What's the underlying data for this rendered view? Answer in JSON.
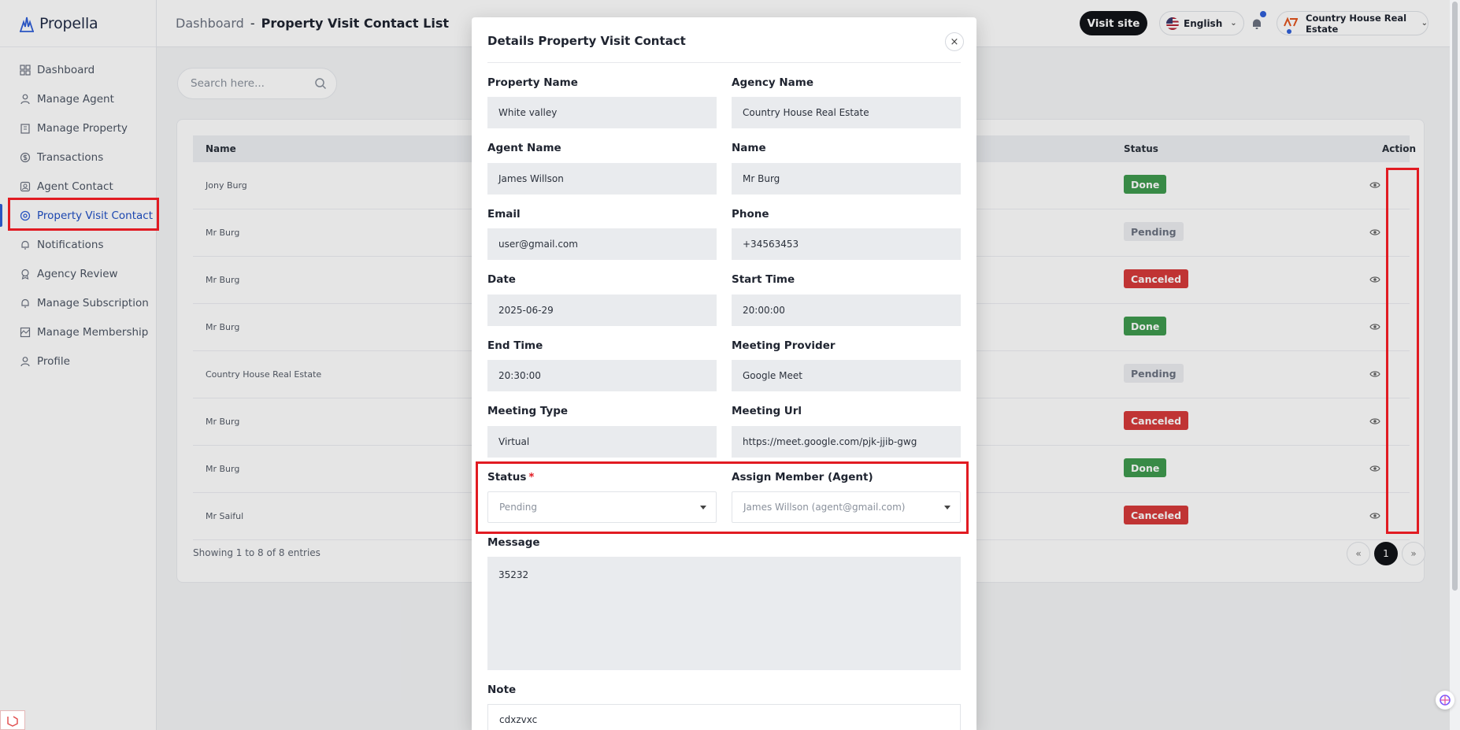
{
  "brand": {
    "name": "Propella"
  },
  "sidebar": {
    "items": [
      {
        "label": "Dashboard",
        "icon": "grid-icon"
      },
      {
        "label": "Manage Agent",
        "icon": "user-tie-icon"
      },
      {
        "label": "Manage Property",
        "icon": "building-icon"
      },
      {
        "label": "Transactions",
        "icon": "dollar-circle-icon"
      },
      {
        "label": "Agent Contact",
        "icon": "contact-card-icon"
      },
      {
        "label": "Property Visit Contact",
        "icon": "visit-icon"
      },
      {
        "label": "Notifications",
        "icon": "bell-icon"
      },
      {
        "label": "Agency Review",
        "icon": "badge-icon"
      },
      {
        "label": "Manage Subscription",
        "icon": "bell-outline-icon"
      },
      {
        "label": "Manage Membership",
        "icon": "membership-icon"
      },
      {
        "label": "Profile",
        "icon": "user-icon"
      }
    ],
    "active_index": 5
  },
  "header": {
    "breadcrumb_root": "Dashboard",
    "breadcrumb_sep": "-",
    "breadcrumb_current": "Property Visit Contact List",
    "visit_site": "Visit site",
    "language": "English",
    "account": "Country House Real Estate"
  },
  "search": {
    "placeholder": "Search here..."
  },
  "table": {
    "columns": {
      "name": "Name",
      "status": "Status",
      "action": "Action"
    },
    "rows": [
      {
        "name": "Jony Burg",
        "status": "Done",
        "kind": "done"
      },
      {
        "name": "Mr Burg",
        "status": "Pending",
        "kind": "pending"
      },
      {
        "name": "Mr Burg",
        "status": "Canceled",
        "kind": "canceled"
      },
      {
        "name": "Mr Burg",
        "status": "Done",
        "kind": "done"
      },
      {
        "name": "Country House Real Estate",
        "status": "Pending",
        "kind": "pending"
      },
      {
        "name": "Mr Burg",
        "status": "Canceled",
        "kind": "canceled"
      },
      {
        "name": "Mr Burg",
        "status": "Done",
        "kind": "done"
      },
      {
        "name": "Mr Saiful",
        "status": "Canceled",
        "kind": "canceled"
      }
    ],
    "entries_text": "Showing 1 to 8 of 8 entries",
    "pagination": {
      "prev": "«",
      "page": "1",
      "next": "»"
    }
  },
  "modal": {
    "title": "Details Property Visit Contact",
    "close": "×",
    "fields": {
      "property_name": {
        "label": "Property Name",
        "value": "White valley"
      },
      "agency_name": {
        "label": "Agency Name",
        "value": "Country House Real Estate"
      },
      "agent_name": {
        "label": "Agent Name",
        "value": "James Willson"
      },
      "name": {
        "label": "Name",
        "value": "Mr Burg"
      },
      "email": {
        "label": "Email",
        "value": "user@gmail.com"
      },
      "phone": {
        "label": "Phone",
        "value": "+34563453"
      },
      "date": {
        "label": "Date",
        "value": "2025-06-29"
      },
      "start_time": {
        "label": "Start Time",
        "value": "20:00:00"
      },
      "end_time": {
        "label": "End Time",
        "value": "20:30:00"
      },
      "meeting_provider": {
        "label": "Meeting Provider",
        "value": "Google Meet"
      },
      "meeting_type": {
        "label": "Meeting Type",
        "value": "Virtual"
      },
      "meeting_url": {
        "label": "Meeting Url",
        "value": "https://meet.google.com/pjk-jjib-gwg"
      },
      "status": {
        "label": "Status",
        "required": "*",
        "value": "Pending"
      },
      "assign_member": {
        "label": "Assign Member (Agent)",
        "value": "James Willson (agent@gmail.com)"
      },
      "message": {
        "label": "Message",
        "value": "35232"
      },
      "note": {
        "label": "Note",
        "value": "cdxzvxc"
      }
    }
  },
  "colors": {
    "accent": "#2f5fd8",
    "highlight": "#e11b22",
    "done": "#3f9a4e",
    "canceled": "#d63a3a"
  }
}
